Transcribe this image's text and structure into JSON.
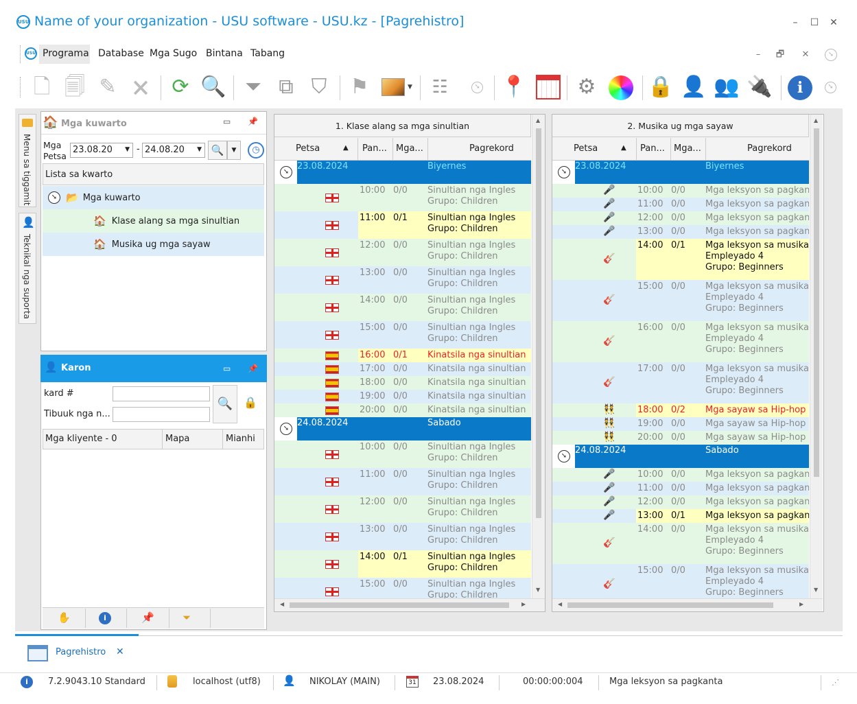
{
  "window": {
    "title": "Name of your organization - USU software - USU.kz - [Pagrehistro]",
    "logo_text": "USU",
    "controls": [
      "–",
      "☐",
      "✕"
    ]
  },
  "menu": {
    "items": [
      "Programa",
      "Database",
      "Mga Sugo",
      "Bintana",
      "Tabang"
    ],
    "mdi_controls": [
      "–",
      "🗗",
      "✕"
    ]
  },
  "sidebar_tabs": {
    "menu": "Menu sa tiggamit",
    "support": "Teknikal nga suporta"
  },
  "rooms_panel": {
    "title": "Mga kuwarto",
    "date_label": "Mga Petsa",
    "date_from": "23.08.20",
    "date_to": "24.08.20",
    "date_sep": "-",
    "list_header": "Lista sa kwarto",
    "tree": {
      "root": "Mga kuwarto",
      "children": [
        "Klase alang sa mga sinultian",
        "Musika ug mga sayaw"
      ]
    }
  },
  "clients_panel": {
    "title": "Karon",
    "card_label": "kard #",
    "card_value": "",
    "name_label": "Tibuuk nga n...",
    "name_value": "",
    "columns": [
      "Mga kliyente - 0",
      "Mapa",
      "Mianhi"
    ]
  },
  "grid_columns": [
    "Petsa",
    "Pan...",
    "Mga...",
    "Pagrekord"
  ],
  "schedules": [
    {
      "title": "1. Klase alang sa mga sinultian",
      "days": [
        {
          "date": "23.08.2024",
          "weekday": "Biyernes"
        },
        {
          "date": "24.08.2024",
          "weekday": "Sabado"
        }
      ],
      "rows": [
        {
          "time": "10:00",
          "count": "0/0",
          "text": [
            "Sinultian nga Ingles",
            "Grupo: Children"
          ]
        },
        {
          "time": "11:00",
          "count": "0/1",
          "text": [
            "Sinultian nga Ingles",
            "Grupo: Children"
          ]
        },
        {
          "time": "12:00",
          "count": "0/0",
          "text": [
            "Sinultian nga Ingles",
            "Grupo: Children"
          ]
        },
        {
          "time": "13:00",
          "count": "0/0",
          "text": [
            "Sinultian nga Ingles",
            "Grupo: Children"
          ]
        },
        {
          "time": "14:00",
          "count": "0/0",
          "text": [
            "Sinultian nga Ingles",
            "Grupo: Children"
          ]
        },
        {
          "time": "15:00",
          "count": "0/0",
          "text": [
            "Sinultian nga Ingles",
            "Grupo: Children"
          ]
        },
        {
          "time": "16:00",
          "count": "0/1",
          "text": [
            "Kinatsila nga sinultian"
          ]
        },
        {
          "time": "17:00",
          "count": "0/0",
          "text": [
            "Kinatsila nga sinultian"
          ]
        },
        {
          "time": "18:00",
          "count": "0/0",
          "text": [
            "Kinatsila nga sinultian"
          ]
        },
        {
          "time": "19:00",
          "count": "0/0",
          "text": [
            "Kinatsila nga sinultian"
          ]
        },
        {
          "time": "20:00",
          "count": "0/0",
          "text": [
            "Kinatsila nga sinultian"
          ]
        },
        {
          "time": "10:00",
          "count": "0/0",
          "text": [
            "Sinultian nga Ingles",
            "Grupo: Children"
          ]
        },
        {
          "time": "11:00",
          "count": "0/0",
          "text": [
            "Sinultian nga Ingles",
            "Grupo: Children"
          ]
        },
        {
          "time": "12:00",
          "count": "0/0",
          "text": [
            "Sinultian nga Ingles",
            "Grupo: Children"
          ]
        },
        {
          "time": "13:00",
          "count": "0/0",
          "text": [
            "Sinultian nga Ingles",
            "Grupo: Children"
          ]
        },
        {
          "time": "14:00",
          "count": "0/1",
          "text": [
            "Sinultian nga Ingles",
            "Grupo: Children"
          ]
        },
        {
          "time": "15:00",
          "count": "0/0",
          "text": [
            "Sinultian nga Ingles",
            "Grupo: Children"
          ]
        }
      ]
    },
    {
      "title": "2. Musika ug mga sayaw",
      "days": [
        {
          "date": "23.08.2024",
          "weekday": "Biyernes"
        },
        {
          "date": "24.08.2024",
          "weekday": "Sabado"
        }
      ],
      "rows": [
        {
          "time": "10:00",
          "count": "0/0",
          "text": [
            "Mga leksyon sa pagkanta"
          ]
        },
        {
          "time": "11:00",
          "count": "0/0",
          "text": [
            "Mga leksyon sa pagkanta"
          ]
        },
        {
          "time": "12:00",
          "count": "0/0",
          "text": [
            "Mga leksyon sa pagkanta"
          ]
        },
        {
          "time": "13:00",
          "count": "0/0",
          "text": [
            "Mga leksyon sa pagkanta"
          ]
        },
        {
          "time": "14:00",
          "count": "0/1",
          "text": [
            "Mga leksyon sa musika",
            "Empleyado 4",
            "Grupo: Beginners"
          ]
        },
        {
          "time": "15:00",
          "count": "0/0",
          "text": [
            "Mga leksyon sa musika",
            "Empleyado 4",
            "Grupo: Beginners"
          ]
        },
        {
          "time": "16:00",
          "count": "0/0",
          "text": [
            "Mga leksyon sa musika",
            "Empleyado 4",
            "Grupo: Beginners"
          ]
        },
        {
          "time": "17:00",
          "count": "0/0",
          "text": [
            "Mga leksyon sa musika",
            "Empleyado 4",
            "Grupo: Beginners"
          ]
        },
        {
          "time": "18:00",
          "count": "0/2",
          "text": [
            "Mga sayaw sa Hip-hop"
          ]
        },
        {
          "time": "19:00",
          "count": "0/0",
          "text": [
            "Mga sayaw sa Hip-hop"
          ]
        },
        {
          "time": "20:00",
          "count": "0/0",
          "text": [
            "Mga sayaw sa Hip-hop"
          ]
        },
        {
          "time": "10:00",
          "count": "0/0",
          "text": [
            "Mga leksyon sa pagkanta"
          ]
        },
        {
          "time": "11:00",
          "count": "0/0",
          "text": [
            "Mga leksyon sa pagkanta"
          ]
        },
        {
          "time": "12:00",
          "count": "0/0",
          "text": [
            "Mga leksyon sa pagkanta"
          ]
        },
        {
          "time": "13:00",
          "count": "0/1",
          "text": [
            "Mga leksyon sa pagkanta"
          ]
        },
        {
          "time": "14:00",
          "count": "0/0",
          "text": [
            "Mga leksyon sa musika",
            "Empleyado 4",
            "Grupo: Beginners"
          ]
        },
        {
          "time": "15:00",
          "count": "0/0",
          "text": [
            "Mga leksyon sa musika",
            "Empleyado 4",
            "Grupo: Beginners"
          ]
        }
      ]
    }
  ],
  "bottom_tab": {
    "label": "Pagrehistro",
    "close": "✕"
  },
  "status": {
    "version": "7.2.9043.10 Standard",
    "db": "localhost (utf8)",
    "user": "NIKOLAY (MAIN)",
    "calendar_day": "31",
    "date": "23.08.2024",
    "timer": "00:00:00:004",
    "current": "Mga leksyon sa pagkanta"
  },
  "colors": {
    "accent": "#1a8fd8",
    "day_row": "#0a79c8",
    "row_green": "#e4f7e4",
    "row_blue": "#dcecf9",
    "row_yellow": "#ffffc0"
  }
}
